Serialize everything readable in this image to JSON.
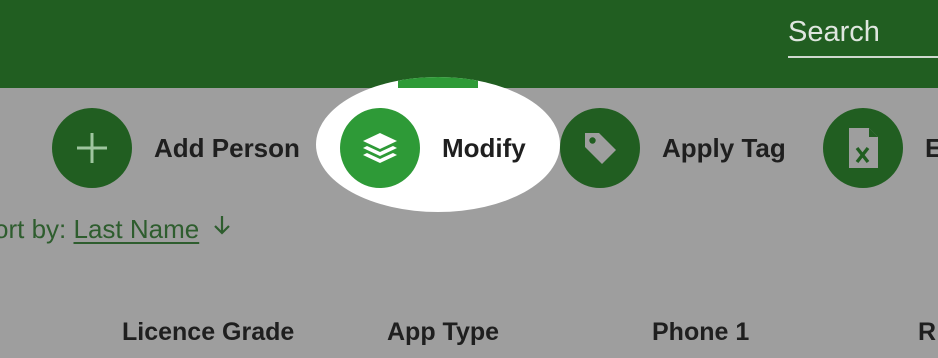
{
  "search": {
    "placeholder": "Search"
  },
  "actions": [
    {
      "label": "Add Person",
      "icon": "plus-icon"
    },
    {
      "label": "Modify",
      "icon": "layers-icon",
      "highlighted": true
    },
    {
      "label": "Apply Tag",
      "icon": "tag-icon"
    },
    {
      "label": "E",
      "icon": "excel-icon"
    }
  ],
  "sort": {
    "prefix": "ort by: ",
    "field": "Last Name",
    "direction": "descending",
    "icon": "arrow-down-icon"
  },
  "columns": [
    "Licence Grade",
    "App Type",
    "Phone 1",
    "R"
  ],
  "colors": {
    "header": "#215e21",
    "action_circle": "#215e21",
    "action_circle_highlight": "#2e9a37",
    "overlay": "#9e9e9e",
    "spotlight": "#ffffff",
    "sort_text": "#2e5d2e"
  }
}
